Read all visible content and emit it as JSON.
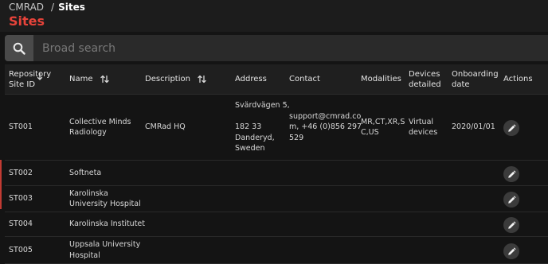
{
  "breadcrumb": {
    "root": "CMRAD",
    "separator": "/",
    "current": "Sites"
  },
  "page_title": "Sites",
  "search": {
    "placeholder": "Broad search"
  },
  "table": {
    "headers": {
      "site_id": [
        "Repository",
        "Site ID"
      ],
      "name": "Name",
      "description": "Description",
      "address": "Address",
      "contact": "Contact",
      "modalities": "Modalities",
      "devices": [
        "Devices",
        "detailed"
      ],
      "onboarding": [
        "Onboarding",
        "date"
      ],
      "actions": "Actions"
    },
    "rows": [
      {
        "site_id": "ST001",
        "name": [
          "Collective Minds",
          "Radiology"
        ],
        "description": "CMRad HQ",
        "address": [
          "Svärdvägen 5,",
          "",
          "182 33",
          "Danderyd,",
          "Sweden"
        ],
        "contact": [
          "support@cmrad.co",
          "m, +46 (0)856 297",
          "529"
        ],
        "modalities": [
          "MR,CT,XR,S",
          "C,US"
        ],
        "devices": [
          "Virtual",
          "devices"
        ],
        "onboarding": "2020/01/01"
      },
      {
        "site_id": "ST002",
        "name": [
          "Softneta"
        ]
      },
      {
        "site_id": "ST003",
        "name": [
          "Karolinska",
          "University Hospital"
        ]
      },
      {
        "site_id": "ST004",
        "name": [
          "Karolinska Institutet"
        ]
      },
      {
        "site_id": "ST005",
        "name": [
          "Uppsala University",
          "Hospital"
        ]
      }
    ]
  },
  "colors": {
    "accent": "#e7433a",
    "background": "#141414",
    "header": "#1f1f1f"
  },
  "icons": {
    "search": "search-icon",
    "sort": "sort-icon",
    "edit": "pencil-icon"
  }
}
